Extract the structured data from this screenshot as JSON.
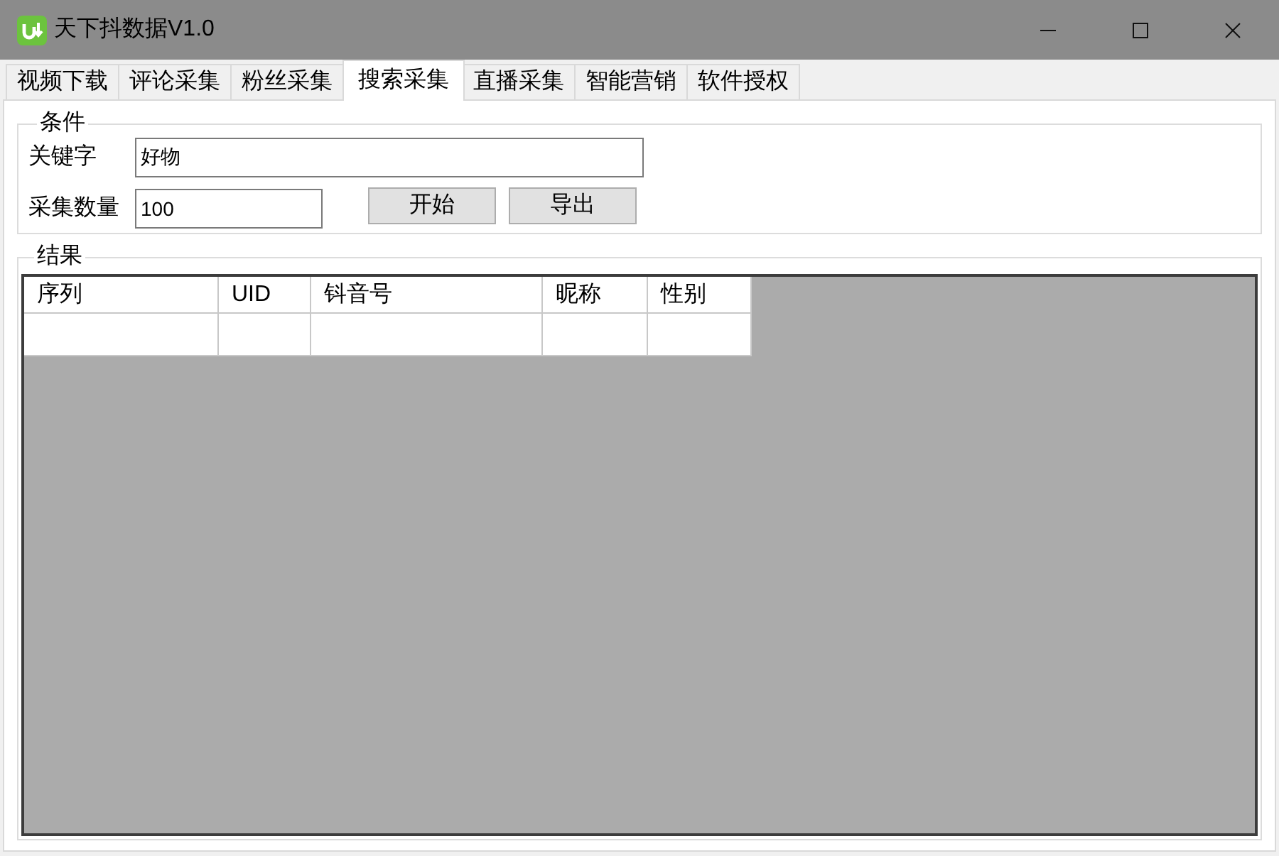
{
  "window": {
    "title": "天下抖数据V1.0"
  },
  "tabs": [
    {
      "label": "视频下载",
      "selected": false
    },
    {
      "label": "评论采集",
      "selected": false
    },
    {
      "label": "粉丝采集",
      "selected": false
    },
    {
      "label": "搜索采集",
      "selected": true
    },
    {
      "label": "直播采集",
      "selected": false
    },
    {
      "label": "智能营销",
      "selected": false
    },
    {
      "label": "软件授权",
      "selected": false
    }
  ],
  "conditions": {
    "title": "条件",
    "fields": [
      {
        "label": "关键字",
        "value": "好物"
      },
      {
        "label": "采集数量",
        "value": "100"
      }
    ],
    "buttons": [
      "开始",
      "导出"
    ]
  },
  "results": {
    "title": "结果",
    "table": {
      "columns": [
        "序列",
        "UID",
        "钭音号",
        "昵称",
        "性别"
      ]
    }
  }
}
